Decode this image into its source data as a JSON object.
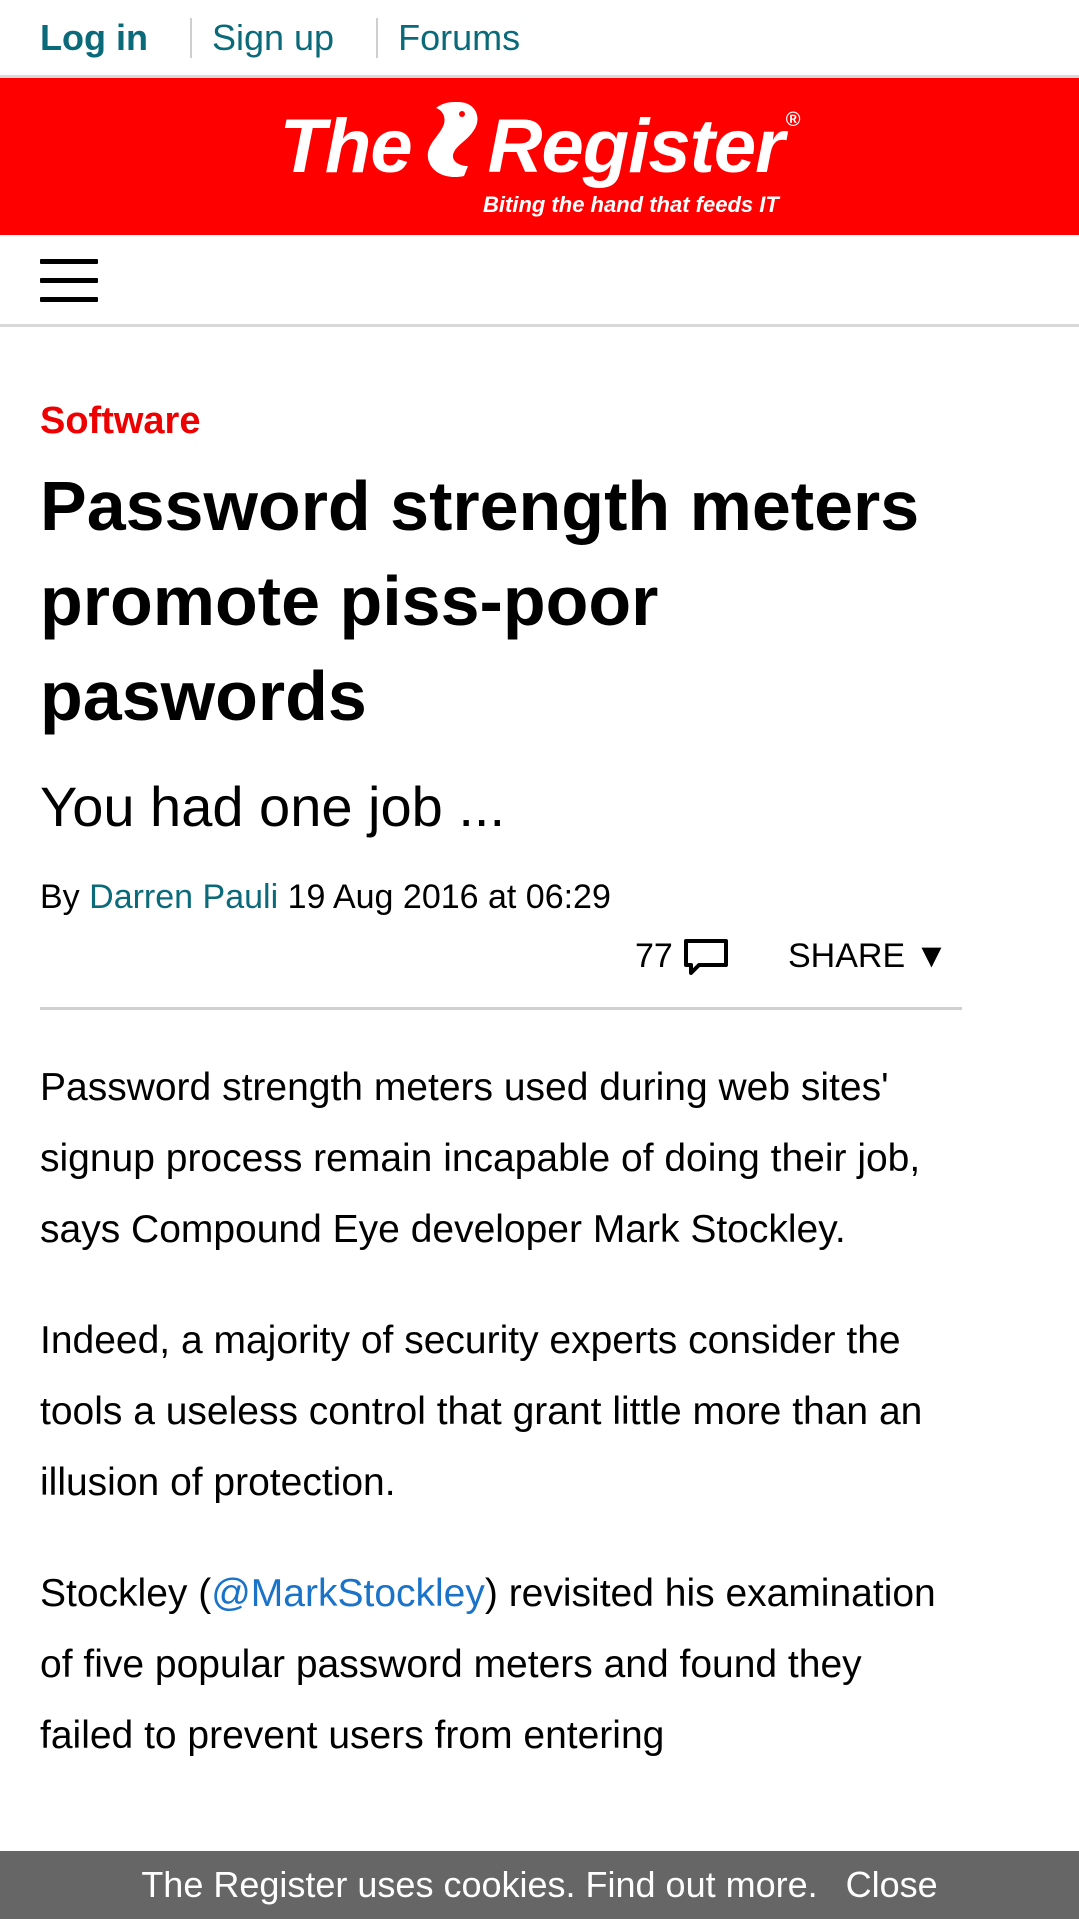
{
  "topnav": {
    "login": "Log in",
    "signup": "Sign up",
    "forums": "Forums"
  },
  "banner": {
    "brand_left": "The",
    "brand_right": "Register",
    "registered": "®",
    "tagline": "Biting the hand that feeds IT"
  },
  "article": {
    "section": "Software",
    "title": "Password strength meters promote piss-poor paswords",
    "standfirst": "You had one job ...",
    "by_label": "By",
    "author": "Darren Pauli",
    "date": "19 Aug 2016 at 06:29",
    "comment_count": "77",
    "share_label": "SHARE ▼",
    "paragraphs": {
      "p1": "Password strength meters used during web sites' signup process remain incapable of doing their job, says Compound Eye developer Mark Stockley.",
      "p2": "Indeed, a majority of security experts consider the tools a useless control that grant little more than an illusion of protection.",
      "p3_before": "Stockley (",
      "p3_link": "@MarkStockley",
      "p3_after": ") revisited his examination of five popular password meters and found they failed to prevent users from entering"
    }
  },
  "cookies": {
    "text": "The Register uses cookies. Find out more.",
    "close": "Close"
  },
  "colors": {
    "brand_red": "#ff0000",
    "link_teal": "#0b6a7a",
    "section_red": "#ee0000",
    "link_blue": "#1a73c8",
    "cookie_bg": "#666666"
  },
  "icons": [
    "hamburger-menu-icon",
    "comment-bubble-icon",
    "vulture-logo-icon"
  ]
}
